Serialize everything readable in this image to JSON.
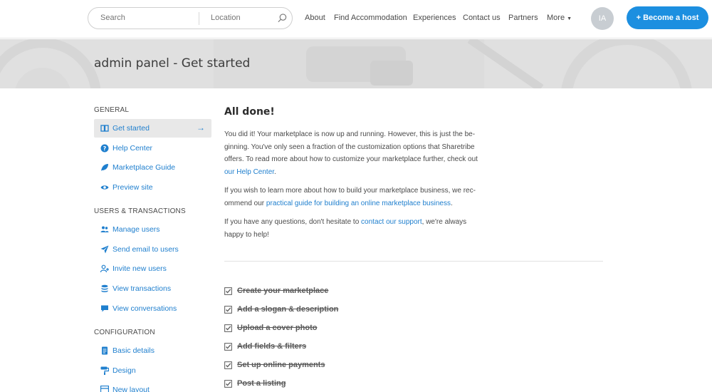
{
  "header": {
    "search_placeholder": "Search",
    "location_placeholder": "Location",
    "nav": {
      "about": "About",
      "find": "Find Accommodation",
      "experiences": "Experiences",
      "contact": "Contact us",
      "partners": "Partners",
      "more": "More"
    },
    "avatar_initials": "IA",
    "become_host": "+ Become a host"
  },
  "hero": {
    "title": "admin panel - Get started"
  },
  "sidebar": {
    "general_heading": "GENERAL",
    "users_heading": "USERS & TRANSACTIONS",
    "config_heading": "CONFIGURATION",
    "items": {
      "get_started": "Get started",
      "help_center": "Help Center",
      "guide": "Marketplace Guide",
      "preview": "Preview site",
      "manage_users": "Manage users",
      "send_email": "Send email to users",
      "invite": "Invite new users",
      "transactions": "View transactions",
      "conversations": "View conversations",
      "basic": "Basic details",
      "design": "Design",
      "new_layout": "New layout"
    },
    "active_arrow": "→"
  },
  "main": {
    "title": "All done!",
    "p1_line1": "You did it! Your marketplace is now up and running. However, this is just the be-",
    "p1_line2": "ginning. You've only seen a fraction of the customization options that Sharetribe",
    "p1_line3": "offers. To read more about how to customize your marketplace further, check out",
    "p1_link": "our Help Center",
    "p1_end": ".",
    "p2_line1": "If you wish to learn more about how to build your marketplace business, we rec-",
    "p2_pre": "ommend our ",
    "p2_link": "practical guide for building an online marketplace business",
    "p2_end": ".",
    "p3_pre": "If you have any questions, don't hesitate to ",
    "p3_link": "contact our support",
    "p3_post": ", we're always",
    "p3_line2": "happy to help!",
    "checklist": [
      "Create your marketplace",
      "Add a slogan & description",
      "Upload a cover photo",
      "Add fields & filters",
      "Set up online payments",
      "Post a listing"
    ]
  },
  "colors": {
    "accent": "#1c8fe0",
    "link": "#1f7fce"
  }
}
